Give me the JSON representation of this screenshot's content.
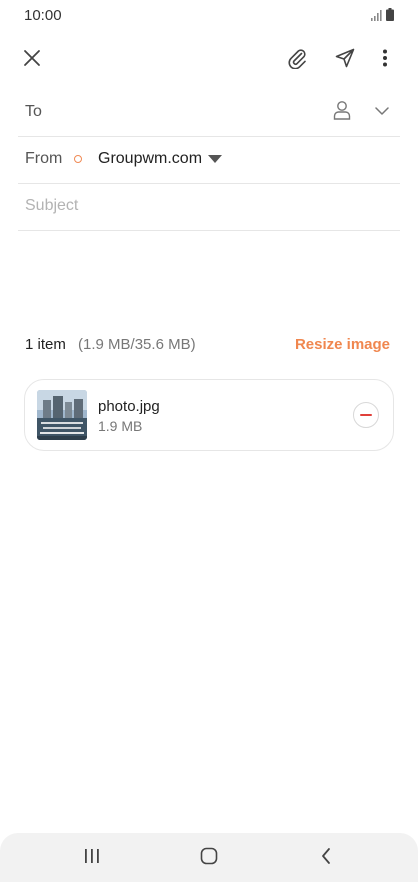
{
  "status_bar": {
    "time": "10:00",
    "icons": [
      "signal-icon",
      "battery-icon"
    ]
  },
  "toolbar": {
    "close_icon": "close-icon",
    "attach_icon": "paperclip-icon",
    "send_icon": "send-icon",
    "more_icon": "more-vertical-icon"
  },
  "compose": {
    "to_label": "To",
    "from_label": "From",
    "from_account": "Groupwm.com",
    "subject_placeholder": "Subject",
    "subject_value": ""
  },
  "attachments": {
    "count_text": "1 item",
    "size_text": "(1.9 MB/35.6 MB)",
    "resize_label": "Resize image",
    "items": [
      {
        "name": "photo.jpg",
        "size": "1.9 MB"
      }
    ]
  },
  "colors": {
    "accent": "#f0874f",
    "remove": "#e0403a",
    "divider": "#e6e6e6"
  },
  "nav_bar": {
    "icons": [
      "recent-apps-icon",
      "home-icon",
      "back-icon"
    ]
  }
}
